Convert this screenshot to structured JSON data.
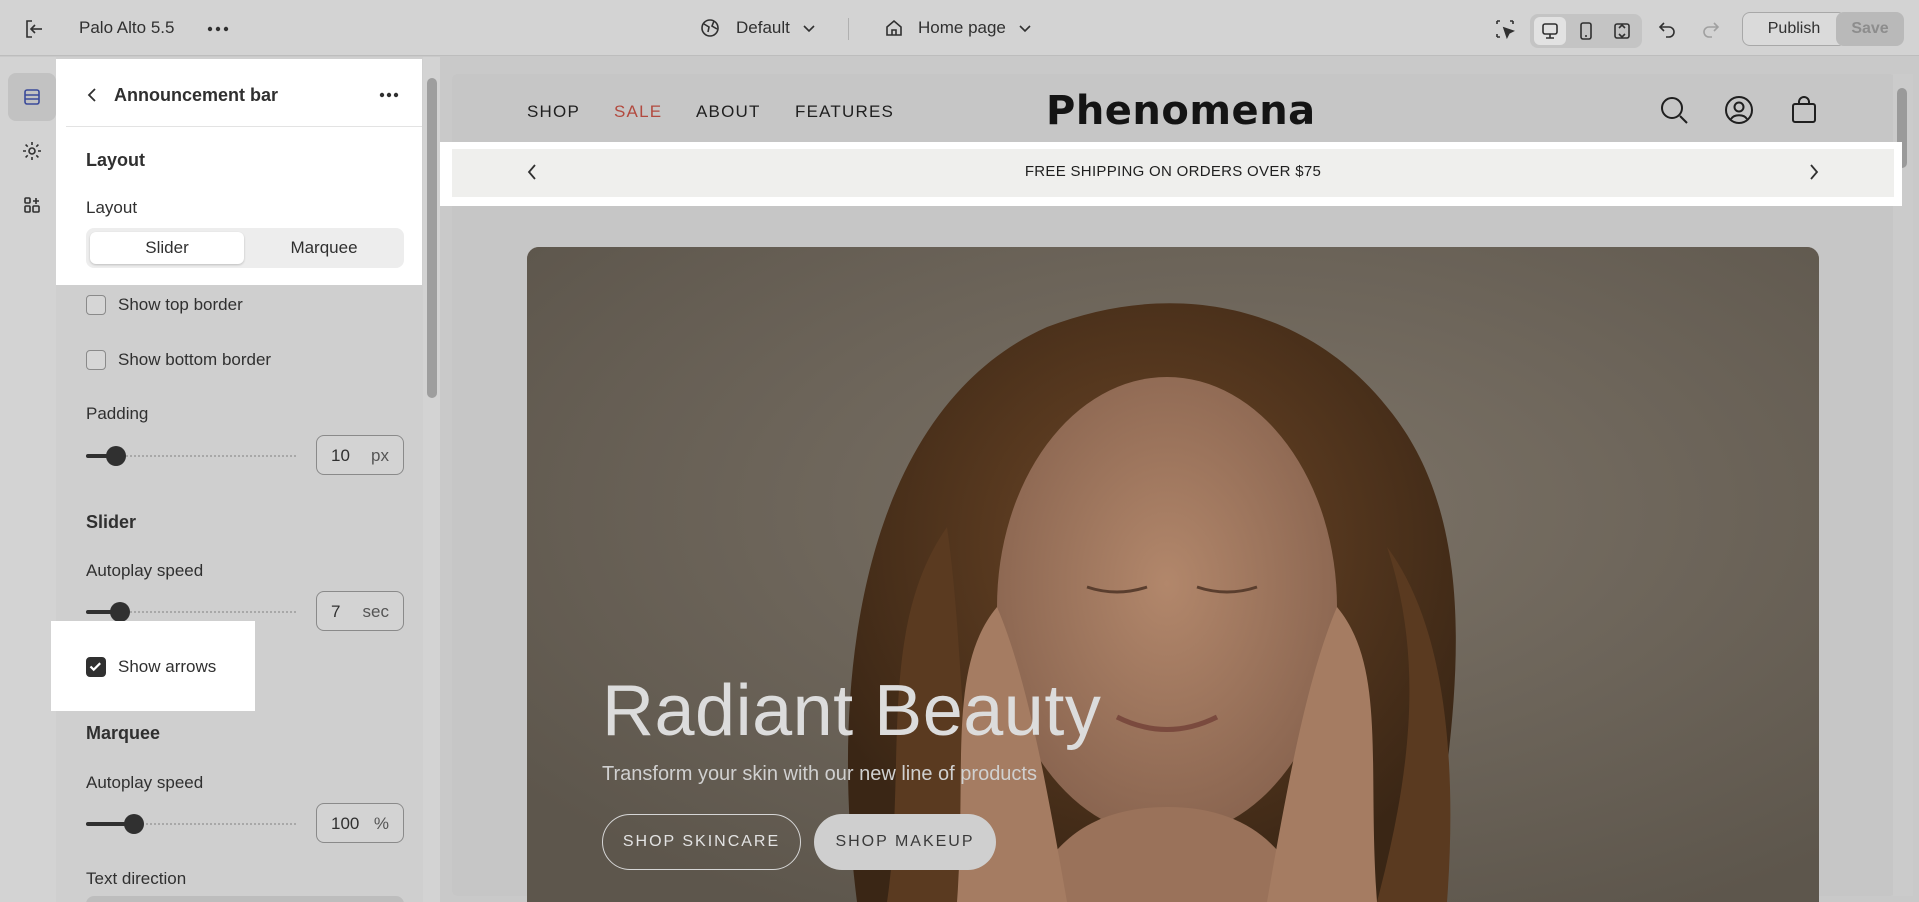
{
  "topbar": {
    "store_name": "Palo Alto 5.5",
    "theme_select": "Default",
    "page_select": "Home page",
    "publish_label": "Publish",
    "save_label": "Save"
  },
  "panel": {
    "title": "Announcement bar",
    "layout_heading": "Layout",
    "layout_label": "Layout",
    "layout_options": [
      "Slider",
      "Marquee"
    ],
    "layout_selected": "Slider",
    "show_top_border_label": "Show top border",
    "show_top_border": false,
    "show_bottom_border_label": "Show bottom border",
    "show_bottom_border": false,
    "padding_label": "Padding",
    "padding_value": "10",
    "padding_unit": "px",
    "slider_heading": "Slider",
    "slider_autoplay_label": "Autoplay speed",
    "slider_autoplay_value": "7",
    "slider_autoplay_unit": "sec",
    "show_arrows_label": "Show arrows",
    "show_arrows": true,
    "marquee_heading": "Marquee",
    "marquee_autoplay_label": "Autoplay speed",
    "marquee_autoplay_value": "100",
    "marquee_autoplay_unit": "%",
    "text_direction_label": "Text direction"
  },
  "preview": {
    "nav": [
      "SHOP",
      "SALE",
      "ABOUT",
      "FEATURES"
    ],
    "logo": "Phenomena",
    "announcement": "FREE SHIPPING ON ORDERS OVER $75",
    "hero_title": "Radiant Beauty",
    "hero_subtitle": "Transform your skin with our new line of products",
    "hero_buttons": [
      "SHOP SKINCARE",
      "SHOP MAKEUP"
    ]
  },
  "colors": {
    "sale_link": "#b24a3f",
    "accent_dark": "#303030"
  }
}
